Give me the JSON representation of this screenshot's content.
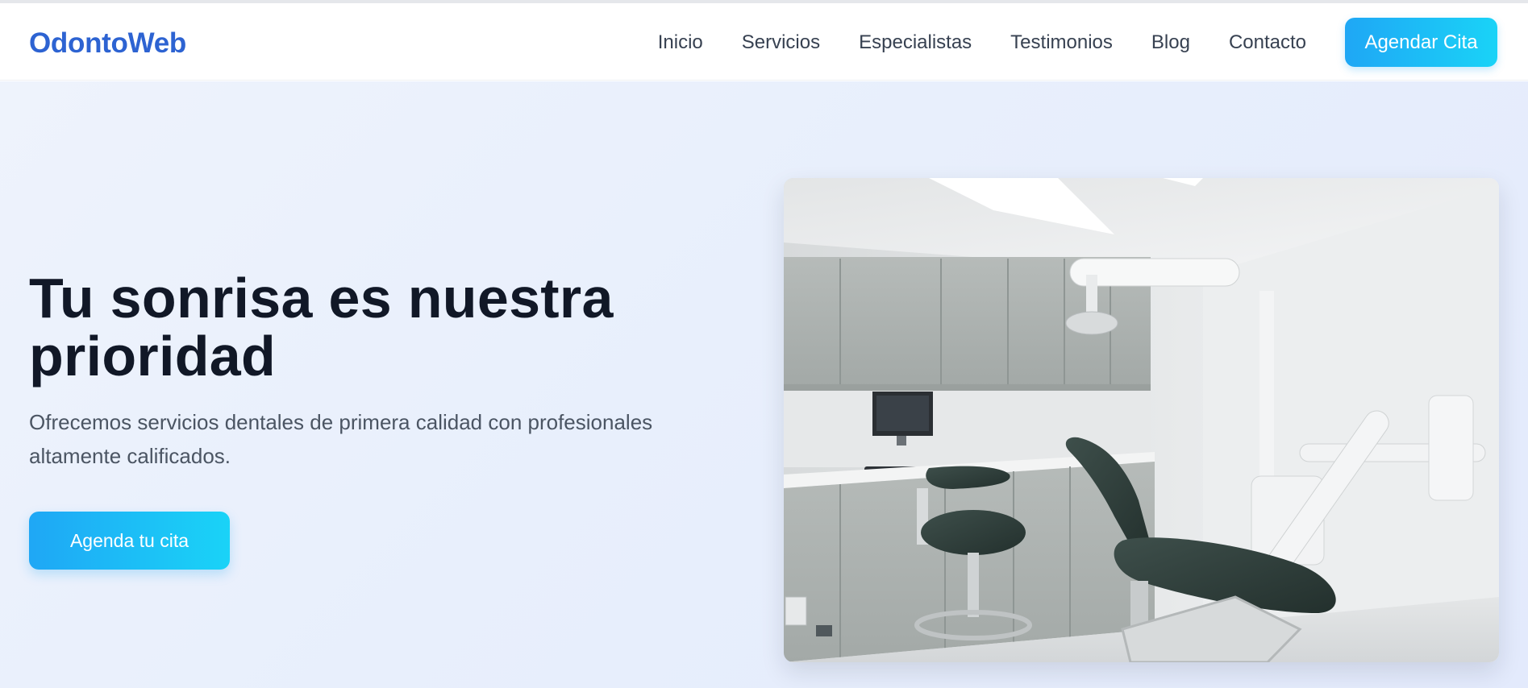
{
  "brand": {
    "name": "OdontoWeb",
    "color": "#2d63d2"
  },
  "nav": {
    "items": [
      {
        "label": "Inicio"
      },
      {
        "label": "Servicios"
      },
      {
        "label": "Especialistas"
      },
      {
        "label": "Testimonios"
      },
      {
        "label": "Blog"
      },
      {
        "label": "Contacto"
      }
    ],
    "cta_label": "Agendar Cita"
  },
  "hero": {
    "title": "Tu sonrisa es nuestra prioridad",
    "subtitle": "Ofrecemos servicios dentales de primera calidad con profesionales altamente calificados.",
    "cta_label": "Agenda tu cita",
    "image_icon": "dental-office-photo"
  },
  "colors": {
    "accent_start": "#1fa7f5",
    "accent_end": "#1ad3f7",
    "title": "#111827",
    "text": "#4b5563",
    "hero_bg": "#e8effc"
  }
}
